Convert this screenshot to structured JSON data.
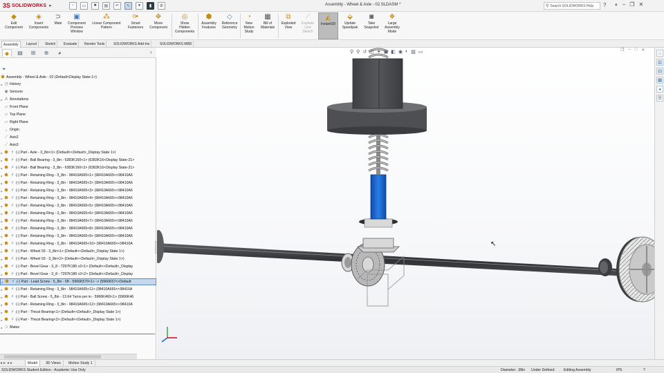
{
  "app": {
    "logo_text": "SOLIDWORKS",
    "document_title": "Assembly - Wheel & Axle - 02.SLDASM *",
    "search_placeholder": "Search SOLIDWORKS Help"
  },
  "ribbon": {
    "buttons": [
      {
        "label": "Edit\nComponent",
        "disabled": false
      },
      {
        "label": "Insert\nComponents",
        "disabled": false
      },
      {
        "label": "Mate",
        "disabled": false
      },
      {
        "label": "Component\nPreview\nWindow",
        "disabled": false
      },
      {
        "label": "Linear Component\nPattern",
        "disabled": false
      },
      {
        "label": "Smart\nFasteners",
        "disabled": false
      },
      {
        "label": "Move\nComponent",
        "disabled": false
      },
      {
        "label": "Show\nHidden\nComponents",
        "disabled": false
      },
      {
        "label": "Assembly\nFeatures",
        "disabled": false
      },
      {
        "label": "Reference\nGeometry",
        "disabled": false
      },
      {
        "label": "New\nMotion\nStudy",
        "disabled": false
      },
      {
        "label": "Bill of\nMaterials",
        "disabled": false
      },
      {
        "label": "Exploded\nView",
        "disabled": false
      },
      {
        "label": "Explode\nLine\nSketch",
        "disabled": true
      },
      {
        "label": "Instant3D",
        "disabled": false,
        "active": true
      },
      {
        "label": "Update\nSpeedpak",
        "disabled": false
      },
      {
        "label": "Take\nSnapshot",
        "disabled": false
      },
      {
        "label": "Large\nAssembly\nMode",
        "disabled": false
      }
    ]
  },
  "command_tabs": [
    "Assembly",
    "Layout",
    "Sketch",
    "Evaluate",
    "Render Tools",
    "SOLIDWORKS Add-Ins",
    "SOLIDWORKS MBD"
  ],
  "tree": {
    "root": "Assembly - Wheel & Axle - 02  (Default<Display State-1>)",
    "items": [
      {
        "label": "History",
        "icon": "history",
        "exp": "▸"
      },
      {
        "label": "Sensors",
        "icon": "sensor",
        "exp": ""
      },
      {
        "label": "Annotations",
        "icon": "annotation",
        "exp": "▸"
      },
      {
        "label": "Front Plane",
        "icon": "plane",
        "exp": ""
      },
      {
        "label": "Top Plane",
        "icon": "plane",
        "exp": ""
      },
      {
        "label": "Right Plane",
        "icon": "plane",
        "exp": ""
      },
      {
        "label": "Origin",
        "icon": "origin",
        "exp": ""
      },
      {
        "label": "Axis2",
        "icon": "axis",
        "exp": ""
      },
      {
        "label": "Axis3",
        "icon": "axis",
        "exp": ""
      },
      {
        "label": "(-) Part - Axle - 3_8in<1> (Default<<Default>_Display State 1>)",
        "icon": "part",
        "exp": "▸"
      },
      {
        "label": "(-) Part - Ball Bearing - 3_8in - 6383K160<1> (6383K16<Display State-21>",
        "icon": "part",
        "exp": "▸"
      },
      {
        "label": "(-) Part - Ball Bearing - 3_8in - 6383K160<2> (6383K16<Display State-21>",
        "icon": "part",
        "exp": "▸"
      },
      {
        "label": "(-) Part - Retaining Ring - 3_8in - 98410A665<1> (98410A665<<98410A6",
        "icon": "part",
        "exp": "▸"
      },
      {
        "label": "(-) Part - Retaining Ring - 3_8in - 98410A665<2> (98410A665<<98410A6",
        "icon": "part",
        "exp": "▸"
      },
      {
        "label": "(-) Part - Retaining Ring - 3_8in - 98410A665<3> (98410A665<<98410A6",
        "icon": "part",
        "exp": "▸"
      },
      {
        "label": "(-) Part - Retaining Ring - 3_8in - 98410A665<4> (98410A665<<98410A6",
        "icon": "part",
        "exp": "▸"
      },
      {
        "label": "(-) Part - Retaining Ring - 3_8in - 98410A665<5> (98410A665<<98410A6",
        "icon": "part",
        "exp": "▸"
      },
      {
        "label": "(-) Part - Retaining Ring - 3_8in - 98410A665<6> (98410A665<<98410A6",
        "icon": "part",
        "exp": "▸"
      },
      {
        "label": "(-) Part - Retaining Ring - 3_8in - 98410A665<7> (98410A665<<98410A6",
        "icon": "part",
        "exp": "▸"
      },
      {
        "label": "(-) Part - Retaining Ring - 3_8in - 98410A665<8> (98410A665<<98410A6",
        "icon": "part",
        "exp": "▸"
      },
      {
        "label": "(-) Part - Retaining Ring - 3_8in - 98410A665<9> (98410A665<<98410A6",
        "icon": "part",
        "exp": "▸"
      },
      {
        "label": "(-) Part - Retaining Ring - 3_8in - 98410A665<10> (98410A665<<98410A",
        "icon": "part",
        "exp": "▸"
      },
      {
        "label": "(-) Part - Wheel 03 - 3_8in<1> (Default<<Default>_Display State 1>)",
        "icon": "part",
        "exp": "▸"
      },
      {
        "label": "(-) Part - Wheel 03 - 3_8in<2> (Default<<Default>_Display State 1>)",
        "icon": "part",
        "exp": "▸"
      },
      {
        "label": "(-) Part - Bevel Gear - 3_8 - 7297K180 v2<1> (Default<<Default>_Display",
        "icon": "part",
        "exp": "▸"
      },
      {
        "label": "(-) Part - Bevel Gear - 3_8 - 7297K180 v2<2> (Default<<Default>_Display",
        "icon": "part",
        "exp": "▸"
      },
      {
        "label": "(-) Part - Lead Screw - 5_8in - 6ft - 5966K570<1> -> (5966K57<<Default",
        "icon": "part",
        "exp": "▸",
        "selected": true
      },
      {
        "label": "(-) Part - Retaining Ring - 3_8in - 98410A665<11> (98410A665<<98410A",
        "icon": "part",
        "exp": "▸"
      },
      {
        "label": "(-) Part - Ball Screw - 5_8in - 13.64 Turns per in - 5966K460<1> (5966K46",
        "icon": "part",
        "exp": "▸"
      },
      {
        "label": "(-) Part - Retaining Ring - 3_8in - 98410A665<12> (98410A665<<98410A",
        "icon": "part",
        "exp": "▸"
      },
      {
        "label": "(-) Part - Thrust Bearing<1> (Default<<Default>_Display State 1>)",
        "icon": "part",
        "exp": "▸"
      },
      {
        "label": "(-) Part - Thrust Bearing<2> (Default<<Default>_Display State 1>)",
        "icon": "part",
        "exp": "▸"
      },
      {
        "label": "Mates",
        "icon": "mates",
        "exp": "▸"
      }
    ]
  },
  "bottom_tabs": [
    "Model",
    "3D Views",
    "Motion Study 1"
  ],
  "status": {
    "edition": "SOLIDWORKS Student Edition - Academic Use Only",
    "measure": "Diameter: .38in",
    "definition": "Under Defined",
    "mode": "Editing Assembly",
    "units": "IPS"
  },
  "colors": {
    "accent_blue": "#3372b8",
    "part_gold": "#c58d18",
    "lead_screw_blue": "#1e63c8",
    "logo_red": "#d0021b"
  }
}
